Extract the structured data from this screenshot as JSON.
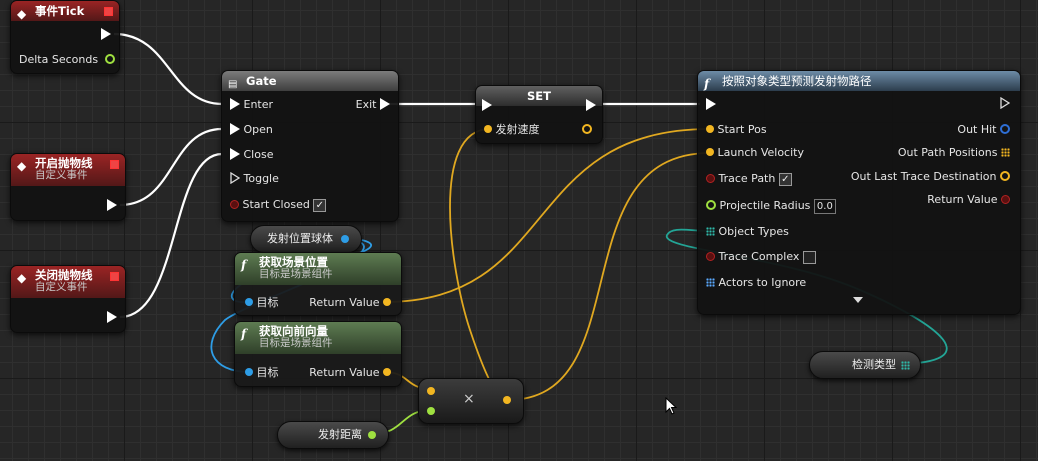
{
  "colors": {
    "exec": "#ffffff",
    "float": "#f2b621",
    "object": "#2e9de6",
    "bool": "#b22222",
    "vector": "#f2b621",
    "struct_float_green": "#9fe040",
    "enum_teal": "#2fb8a8",
    "event_header": "#9a2424",
    "function_header": "#6d8ca7",
    "pure_header": "#5e7c52"
  },
  "nodes": {
    "event_tick": {
      "title": "事件Tick",
      "delta_seconds": "Delta Seconds"
    },
    "event_open": {
      "title": "开启抛物线",
      "subtitle": "自定义事件"
    },
    "event_close": {
      "title": "关闭抛物线",
      "subtitle": "自定义事件"
    },
    "gate": {
      "title": "Gate",
      "enter": "Enter",
      "exit": "Exit",
      "open": "Open",
      "close": "Close",
      "toggle": "Toggle",
      "start_closed": "Start Closed",
      "start_closed_checked": true
    },
    "set": {
      "title": "SET",
      "var": "发射速度"
    },
    "predict": {
      "title": "按照对象类型预测发射物路径",
      "start_pos": "Start Pos",
      "launch_velocity": "Launch Velocity",
      "trace_path": "Trace Path",
      "trace_path_checked": true,
      "projectile_radius": "Projectile Radius",
      "projectile_radius_value": "0.0",
      "object_types": "Object Types",
      "trace_complex": "Trace Complex",
      "trace_complex_checked": false,
      "actors_to_ignore": "Actors to Ignore",
      "out_hit": "Out Hit",
      "out_path_positions": "Out Path Positions",
      "out_last_trace_destination": "Out Last Trace Destination",
      "return_value": "Return Value"
    },
    "get_location": {
      "title": "获取场景位置",
      "subtitle": "目标是场景组件",
      "target": "目标",
      "return": "Return Value"
    },
    "get_forward": {
      "title": "获取向前向量",
      "subtitle": "目标是场景组件",
      "target": "目标",
      "return": "Return Value"
    },
    "multiply": {
      "symbol": "×"
    },
    "var_sphere": {
      "label": "发射位置球体"
    },
    "var_distance": {
      "label": "发射距离"
    },
    "var_detect": {
      "label": "检测类型"
    }
  }
}
